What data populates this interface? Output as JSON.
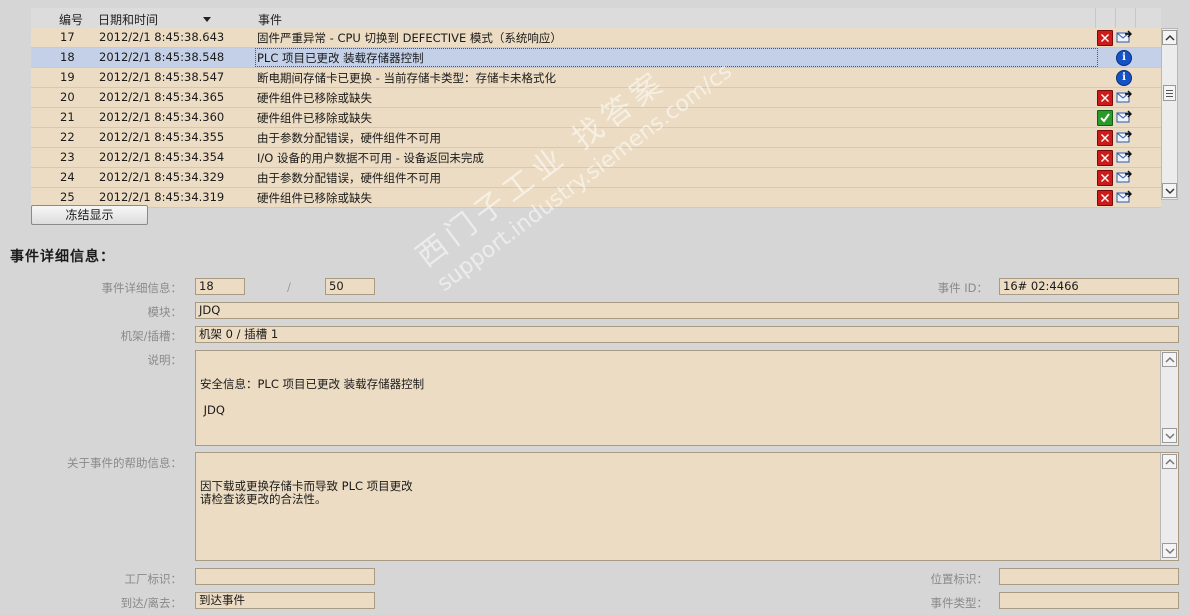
{
  "table": {
    "columns": {
      "no": "编号",
      "datetime": "日期和时间",
      "event": "事件"
    },
    "rows": [
      {
        "no": "17",
        "datetime": "2012/2/1 8:45:38.643",
        "event": "固件严重异常 - CPU 切换到 DEFECTIVE 模式（系统响应）",
        "icon1": "error-icon",
        "icon2": "goto-icon",
        "selected": false
      },
      {
        "no": "18",
        "datetime": "2012/2/1 8:45:38.548",
        "event": "PLC 项目已更改 装载存储器控制",
        "icon1": "",
        "icon2": "info-icon",
        "selected": true
      },
      {
        "no": "19",
        "datetime": "2012/2/1 8:45:38.547",
        "event": "断电期间存储卡已更换 - 当前存储卡类型：存储卡未格式化",
        "icon1": "",
        "icon2": "info-icon",
        "selected": false
      },
      {
        "no": "20",
        "datetime": "2012/2/1 8:45:34.365",
        "event": "硬件组件已移除或缺失",
        "icon1": "error-icon",
        "icon2": "goto-icon",
        "selected": false
      },
      {
        "no": "21",
        "datetime": "2012/2/1 8:45:34.360",
        "event": "硬件组件已移除或缺失",
        "icon1": "ok-icon",
        "icon2": "goto-icon",
        "selected": false
      },
      {
        "no": "22",
        "datetime": "2012/2/1 8:45:34.355",
        "event": "由于参数分配错误，硬件组件不可用",
        "icon1": "error-icon",
        "icon2": "goto-icon",
        "selected": false
      },
      {
        "no": "23",
        "datetime": "2012/2/1 8:45:34.354",
        "event": "I/O 设备的用户数据不可用 - 设备返回未完成",
        "icon1": "error-icon",
        "icon2": "goto-icon",
        "selected": false
      },
      {
        "no": "24",
        "datetime": "2012/2/1 8:45:34.329",
        "event": "由于参数分配错误，硬件组件不可用",
        "icon1": "error-icon",
        "icon2": "goto-icon",
        "selected": false
      },
      {
        "no": "25",
        "datetime": "2012/2/1 8:45:34.319",
        "event": "硬件组件已移除或缺失",
        "icon1": "error-icon",
        "icon2": "goto-icon",
        "selected": false
      }
    ]
  },
  "freeze_button": "冻结显示",
  "details": {
    "title": "事件详细信息：",
    "detail_label": "事件详细信息：",
    "detail_index": "18",
    "separator": "/",
    "detail_total": "50",
    "event_id_label": "事件 ID：",
    "event_id": "16# 02:4466",
    "module_label": "模块：",
    "module": "JDQ",
    "rack_label": "机架/插槽：",
    "rack": "机架 0 / 插槽 1",
    "desc_label": "说明：",
    "description": "安全信息：PLC 项目已更改 装载存储器控制\n\n JDQ",
    "help_label": "关于事件的帮助信息：",
    "help": "因下载或更换存储卡而导致 PLC 项目更改\n请检查该更改的合法性。",
    "plant_label": "工厂标识：",
    "plant": "",
    "location_label": "位置标识：",
    "location": "",
    "arrival_label": "到达/离去：",
    "arrival": "到达事件",
    "type_label": "事件类型：",
    "type": ""
  },
  "watermark": {
    "line1": "西门子工业  找答案",
    "line2": "support.industry.siemens.com/cs"
  },
  "colors": {
    "row_bg": "#ecdcc3",
    "row_selected": "#c3d0e8",
    "error": "#cc1b1b",
    "ok": "#2a9a2a",
    "info": "#1552c6"
  }
}
